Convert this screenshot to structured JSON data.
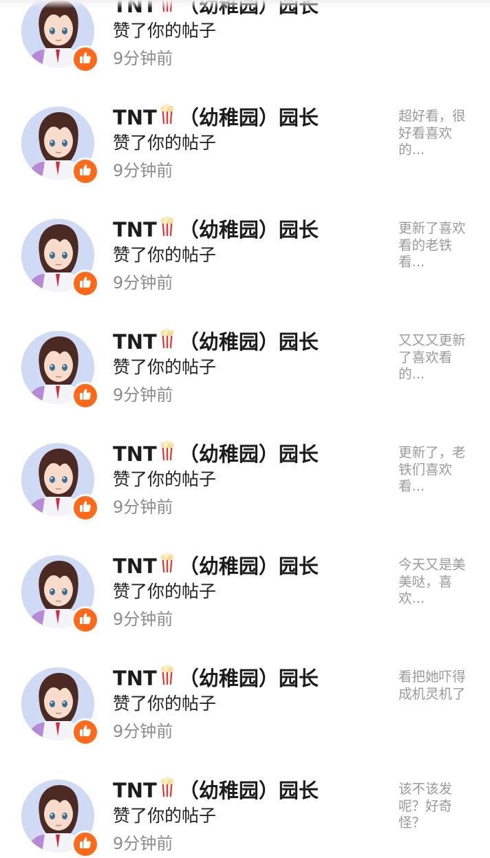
{
  "colors": {
    "like_badge": "#ff6a1a",
    "name_text": "#1c1c1c",
    "time_text": "#8c8c8c",
    "preview_text": "#9a9a9a"
  },
  "items": [
    {
      "user": "TNT",
      "user_emoji": "popcorn",
      "user_suffix": "（幼稚园）园长",
      "action": "赞了你的帖子",
      "time": "9分钟前",
      "preview": "",
      "badge_icon": "thumbs-up-icon"
    },
    {
      "user": "TNT",
      "user_emoji": "popcorn",
      "user_suffix": "（幼稚园）园长",
      "action": "赞了你的帖子",
      "time": "9分钟前",
      "preview": "超好看，很好看喜欢的...",
      "badge_icon": "thumbs-up-icon"
    },
    {
      "user": "TNT",
      "user_emoji": "popcorn",
      "user_suffix": "（幼稚园）园长",
      "action": "赞了你的帖子",
      "time": "9分钟前",
      "preview": "更新了喜欢看的老铁看...",
      "badge_icon": "thumbs-up-icon"
    },
    {
      "user": "TNT",
      "user_emoji": "popcorn",
      "user_suffix": "（幼稚园）园长",
      "action": "赞了你的帖子",
      "time": "9分钟前",
      "preview": "又又又更新了喜欢看的...",
      "badge_icon": "thumbs-up-icon"
    },
    {
      "user": "TNT",
      "user_emoji": "popcorn",
      "user_suffix": "（幼稚园）园长",
      "action": "赞了你的帖子",
      "time": "9分钟前",
      "preview": "更新了，老铁们喜欢看...",
      "badge_icon": "thumbs-up-icon"
    },
    {
      "user": "TNT",
      "user_emoji": "popcorn",
      "user_suffix": "（幼稚园）园长",
      "action": "赞了你的帖子",
      "time": "9分钟前",
      "preview": "今天又是美美哒，喜欢...",
      "badge_icon": "thumbs-up-icon"
    },
    {
      "user": "TNT",
      "user_emoji": "popcorn",
      "user_suffix": "（幼稚园）园长",
      "action": "赞了你的帖子",
      "time": "9分钟前",
      "preview": "看把她吓得成机灵机了",
      "badge_icon": "thumbs-up-icon"
    },
    {
      "user": "TNT",
      "user_emoji": "popcorn",
      "user_suffix": "（幼稚园）园长",
      "action": "赞了你的帖子",
      "time": "9分钟前",
      "preview": "该不该发呢？好奇怪？",
      "badge_icon": "thumbs-up-icon"
    }
  ]
}
